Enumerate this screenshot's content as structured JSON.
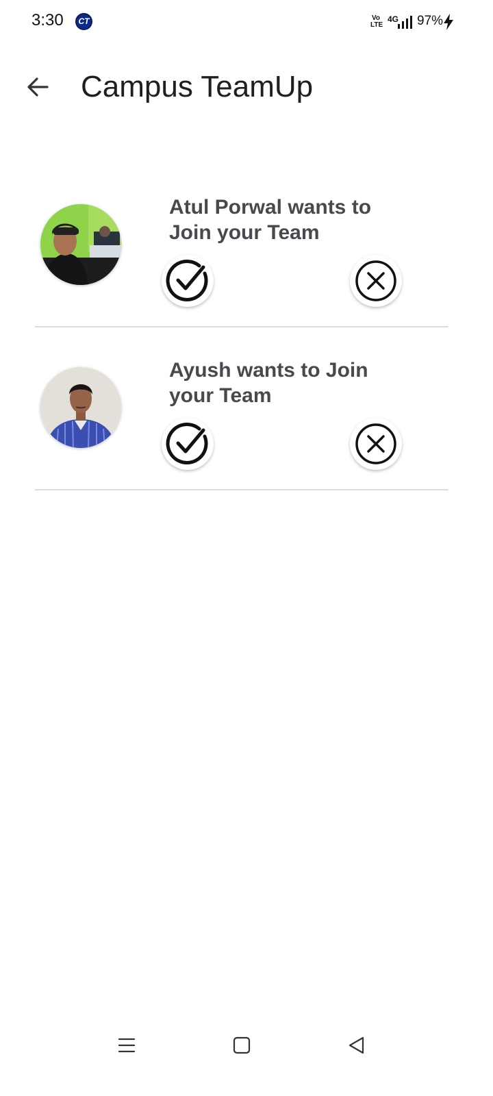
{
  "status_bar": {
    "time": "3:30",
    "app_badge": "CT",
    "volte_line1": "Vo",
    "volte_line2": "LTE",
    "network": "4G",
    "battery": "97%"
  },
  "app_bar": {
    "title": "Campus TeamUp"
  },
  "requests": [
    {
      "message": "Atul Porwal wants to Join your Team",
      "accept_icon": "check-circle-icon",
      "reject_icon": "x-circle-icon"
    },
    {
      "message": "Ayush wants to Join your Team",
      "accept_icon": "check-circle-icon",
      "reject_icon": "x-circle-icon"
    }
  ],
  "nav_bar": {
    "icons": [
      "menu-icon",
      "home-square-icon",
      "back-triangle-icon"
    ]
  },
  "colors": {
    "text_primary": "#1f1f1f",
    "request_text": "#48484f",
    "divider": "#dcdcdc",
    "badge_blue": "#0c2a8c"
  }
}
